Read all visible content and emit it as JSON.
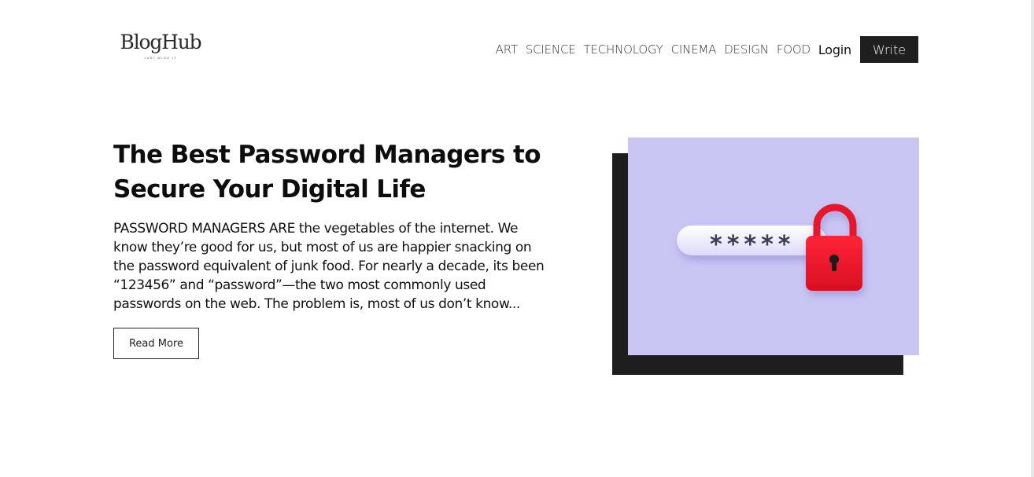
{
  "header": {
    "logo_name": "BlogHub",
    "logo_tagline": "JUST BLOG IT",
    "nav": [
      "ART",
      "SCIENCE",
      "TECHNOLOGY",
      "CINEMA",
      "DESIGN",
      "FOOD"
    ],
    "login_label": "Login",
    "write_label": "Write"
  },
  "post": {
    "title": "The Best Password Managers to Secure Your Digital Life",
    "excerpt": "PASSWORD MANAGERS ARE the vegetables of the internet. We know they’re good for us, but most of us are happier snacking on the password equivalent of junk food. For nearly a decade, its been “123456” and “password”—the two most commonly used passwords on the web. The problem is, most of us don’t know...",
    "read_more_label": "Read More",
    "image": {
      "background": "#c9c6f3",
      "lock_color": "#e8132a",
      "password_mask": "*****",
      "icon": "padlock-icon"
    }
  },
  "colors": {
    "accent_dark": "#1f1f1f",
    "text": "#111111"
  }
}
